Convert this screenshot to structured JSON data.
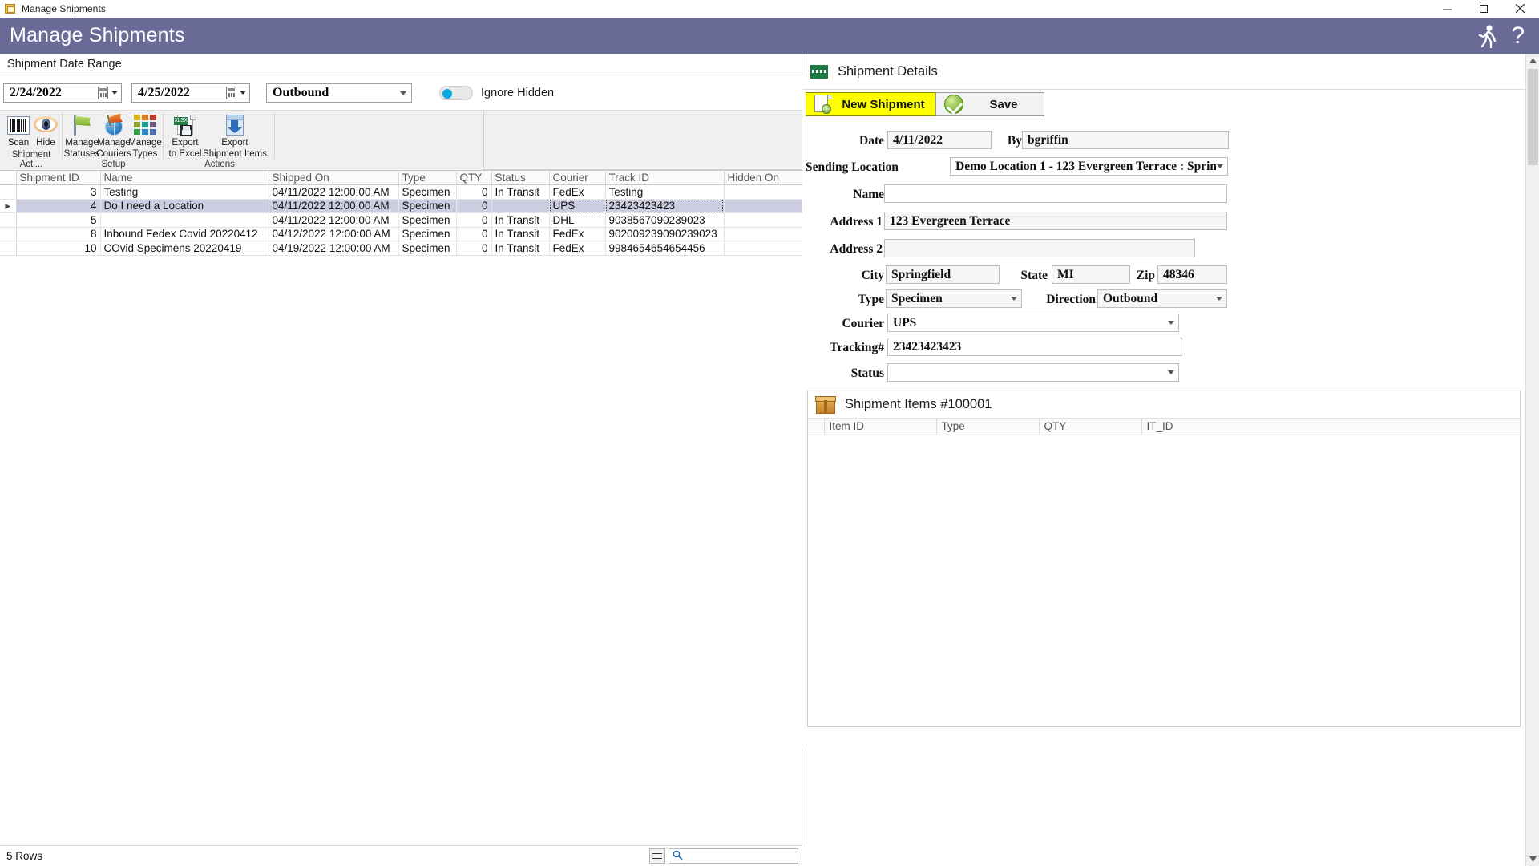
{
  "window": {
    "title": "Manage Shipments",
    "icon": "app-window-icon",
    "buttons": {
      "minimize": "minimize-icon",
      "maximize": "maximize-icon",
      "close": "close-icon"
    }
  },
  "header": {
    "title": "Manage Shipments",
    "accent_color": "#696a96",
    "icons": [
      "person-running-icon",
      "help-icon"
    ],
    "help_glyph": "?"
  },
  "left": {
    "group_title": "Shipment Date Range",
    "filters": {
      "date_from": "2/24/2022",
      "date_to": "4/25/2022",
      "direction": "Outbound",
      "ignore_hidden_label": "Ignore Hidden",
      "ignore_hidden_on": true
    },
    "ribbon": {
      "groups": [
        {
          "caption": "Shipment Acti...",
          "buttons": [
            {
              "label_line1": "Scan",
              "label_line2": "",
              "icon": "barcode-icon"
            },
            {
              "label_line1": "Hide",
              "label_line2": "",
              "icon": "eye-icon"
            }
          ]
        },
        {
          "caption": "Setup",
          "buttons": [
            {
              "label_line1": "Manage",
              "label_line2": "Statuses",
              "icon": "flag-icon"
            },
            {
              "label_line1": "Manage",
              "label_line2": "Couriers",
              "icon": "globe-flag-icon"
            },
            {
              "label_line1": "Manage",
              "label_line2": "Types",
              "icon": "color-grid-icon"
            }
          ]
        },
        {
          "caption": "Actions",
          "buttons": [
            {
              "label_line1": "Export",
              "label_line2": "to Excel",
              "icon": "xlsx-save-icon"
            },
            {
              "label_line1": "Export",
              "label_line2": "Shipment Items",
              "icon": "download-box-icon"
            }
          ]
        }
      ]
    },
    "grid": {
      "columns": [
        "Shipment ID",
        "Name",
        "Shipped On",
        "Type",
        "QTY",
        "Status",
        "Courier",
        "Track ID",
        "Hidden On"
      ],
      "rows": [
        {
          "selected": false,
          "marker": "",
          "cells": [
            "3",
            "Testing",
            "04/11/2022 12:00:00 AM",
            "Specimen",
            "0",
            "In Transit",
            "FedEx",
            "Testing",
            ""
          ]
        },
        {
          "selected": true,
          "marker": "▸",
          "cells": [
            "4",
            "Do I need a Location",
            "04/11/2022 12:00:00 AM",
            "Specimen",
            "0",
            "",
            "UPS",
            "23423423423",
            ""
          ]
        },
        {
          "selected": false,
          "marker": "",
          "cells": [
            "5",
            "",
            "04/11/2022 12:00:00 AM",
            "Specimen",
            "0",
            "In Transit",
            "DHL",
            "9038567090239023",
            ""
          ]
        },
        {
          "selected": false,
          "marker": "",
          "cells": [
            "8",
            "Inbound Fedex Covid 20220412",
            "04/12/2022 12:00:00 AM",
            "Specimen",
            "0",
            "In Transit",
            "FedEx",
            "902009239090239023",
            ""
          ]
        },
        {
          "selected": false,
          "marker": "",
          "cells": [
            "10",
            "COvid Specimens 20220419",
            "04/19/2022 12:00:00 AM",
            "Specimen",
            "0",
            "In Transit",
            "FedEx",
            "9984654654654456",
            ""
          ]
        }
      ]
    },
    "status": {
      "rows_text": "5 Rows",
      "menu_icon": "hamburger-icon",
      "search_icon": "search-icon",
      "search_value": ""
    }
  },
  "right": {
    "panel_title": "Shipment Details",
    "panel_icon": "shipment-box-icon",
    "new_shipment_label": "New Shipment",
    "save_label": "Save",
    "fields": {
      "date_label": "Date",
      "date_value": "4/11/2022",
      "by_label": "By",
      "by_value": "bgriffin",
      "sending_location_label": "Sending Location",
      "sending_location_value": "Demo Location 1 - 123 Evergreen Terrace  : Sprin",
      "name_label": "Name",
      "name_value": "",
      "address1_label": "Address 1",
      "address1_value": "123 Evergreen Terrace",
      "address2_label": "Address 2",
      "address2_value": "",
      "city_label": "City",
      "city_value": "Springfield",
      "state_label": "State",
      "state_value": "MI",
      "zip_label": "Zip",
      "zip_value": "48346",
      "type_label": "Type",
      "type_value": "Specimen",
      "direction_label": "Direction",
      "direction_value": "Outbound",
      "courier_label": "Courier",
      "courier_value": "UPS",
      "tracking_label": "Tracking#",
      "tracking_value": "23423423423",
      "status_label": "Status",
      "status_value": ""
    },
    "items": {
      "title": "Shipment Items #100001",
      "icon": "open-box-icon",
      "columns": [
        "Item ID",
        "Type",
        "QTY",
        "IT_ID"
      ],
      "rows": []
    }
  }
}
